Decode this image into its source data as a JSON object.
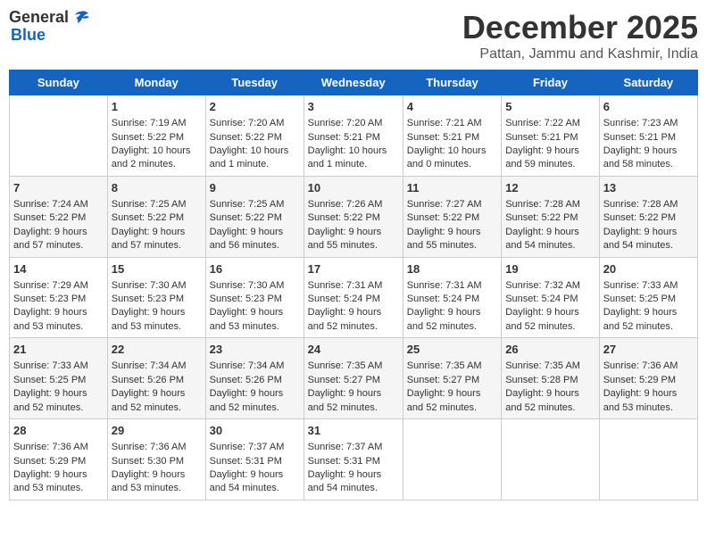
{
  "logo": {
    "general": "General",
    "blue": "Blue"
  },
  "title": "December 2025",
  "location": "Pattan, Jammu and Kashmir, India",
  "weekdays": [
    "Sunday",
    "Monday",
    "Tuesday",
    "Wednesday",
    "Thursday",
    "Friday",
    "Saturday"
  ],
  "weeks": [
    [
      {
        "day": "",
        "sunrise": "",
        "sunset": "",
        "daylight": ""
      },
      {
        "day": "1",
        "sunrise": "Sunrise: 7:19 AM",
        "sunset": "Sunset: 5:22 PM",
        "daylight": "Daylight: 10 hours and 2 minutes."
      },
      {
        "day": "2",
        "sunrise": "Sunrise: 7:20 AM",
        "sunset": "Sunset: 5:22 PM",
        "daylight": "Daylight: 10 hours and 1 minute."
      },
      {
        "day": "3",
        "sunrise": "Sunrise: 7:20 AM",
        "sunset": "Sunset: 5:21 PM",
        "daylight": "Daylight: 10 hours and 1 minute."
      },
      {
        "day": "4",
        "sunrise": "Sunrise: 7:21 AM",
        "sunset": "Sunset: 5:21 PM",
        "daylight": "Daylight: 10 hours and 0 minutes."
      },
      {
        "day": "5",
        "sunrise": "Sunrise: 7:22 AM",
        "sunset": "Sunset: 5:21 PM",
        "daylight": "Daylight: 9 hours and 59 minutes."
      },
      {
        "day": "6",
        "sunrise": "Sunrise: 7:23 AM",
        "sunset": "Sunset: 5:21 PM",
        "daylight": "Daylight: 9 hours and 58 minutes."
      }
    ],
    [
      {
        "day": "7",
        "sunrise": "Sunrise: 7:24 AM",
        "sunset": "Sunset: 5:22 PM",
        "daylight": "Daylight: 9 hours and 57 minutes."
      },
      {
        "day": "8",
        "sunrise": "Sunrise: 7:25 AM",
        "sunset": "Sunset: 5:22 PM",
        "daylight": "Daylight: 9 hours and 57 minutes."
      },
      {
        "day": "9",
        "sunrise": "Sunrise: 7:25 AM",
        "sunset": "Sunset: 5:22 PM",
        "daylight": "Daylight: 9 hours and 56 minutes."
      },
      {
        "day": "10",
        "sunrise": "Sunrise: 7:26 AM",
        "sunset": "Sunset: 5:22 PM",
        "daylight": "Daylight: 9 hours and 55 minutes."
      },
      {
        "day": "11",
        "sunrise": "Sunrise: 7:27 AM",
        "sunset": "Sunset: 5:22 PM",
        "daylight": "Daylight: 9 hours and 55 minutes."
      },
      {
        "day": "12",
        "sunrise": "Sunrise: 7:28 AM",
        "sunset": "Sunset: 5:22 PM",
        "daylight": "Daylight: 9 hours and 54 minutes."
      },
      {
        "day": "13",
        "sunrise": "Sunrise: 7:28 AM",
        "sunset": "Sunset: 5:22 PM",
        "daylight": "Daylight: 9 hours and 54 minutes."
      }
    ],
    [
      {
        "day": "14",
        "sunrise": "Sunrise: 7:29 AM",
        "sunset": "Sunset: 5:23 PM",
        "daylight": "Daylight: 9 hours and 53 minutes."
      },
      {
        "day": "15",
        "sunrise": "Sunrise: 7:30 AM",
        "sunset": "Sunset: 5:23 PM",
        "daylight": "Daylight: 9 hours and 53 minutes."
      },
      {
        "day": "16",
        "sunrise": "Sunrise: 7:30 AM",
        "sunset": "Sunset: 5:23 PM",
        "daylight": "Daylight: 9 hours and 53 minutes."
      },
      {
        "day": "17",
        "sunrise": "Sunrise: 7:31 AM",
        "sunset": "Sunset: 5:24 PM",
        "daylight": "Daylight: 9 hours and 52 minutes."
      },
      {
        "day": "18",
        "sunrise": "Sunrise: 7:31 AM",
        "sunset": "Sunset: 5:24 PM",
        "daylight": "Daylight: 9 hours and 52 minutes."
      },
      {
        "day": "19",
        "sunrise": "Sunrise: 7:32 AM",
        "sunset": "Sunset: 5:24 PM",
        "daylight": "Daylight: 9 hours and 52 minutes."
      },
      {
        "day": "20",
        "sunrise": "Sunrise: 7:33 AM",
        "sunset": "Sunset: 5:25 PM",
        "daylight": "Daylight: 9 hours and 52 minutes."
      }
    ],
    [
      {
        "day": "21",
        "sunrise": "Sunrise: 7:33 AM",
        "sunset": "Sunset: 5:25 PM",
        "daylight": "Daylight: 9 hours and 52 minutes."
      },
      {
        "day": "22",
        "sunrise": "Sunrise: 7:34 AM",
        "sunset": "Sunset: 5:26 PM",
        "daylight": "Daylight: 9 hours and 52 minutes."
      },
      {
        "day": "23",
        "sunrise": "Sunrise: 7:34 AM",
        "sunset": "Sunset: 5:26 PM",
        "daylight": "Daylight: 9 hours and 52 minutes."
      },
      {
        "day": "24",
        "sunrise": "Sunrise: 7:35 AM",
        "sunset": "Sunset: 5:27 PM",
        "daylight": "Daylight: 9 hours and 52 minutes."
      },
      {
        "day": "25",
        "sunrise": "Sunrise: 7:35 AM",
        "sunset": "Sunset: 5:27 PM",
        "daylight": "Daylight: 9 hours and 52 minutes."
      },
      {
        "day": "26",
        "sunrise": "Sunrise: 7:35 AM",
        "sunset": "Sunset: 5:28 PM",
        "daylight": "Daylight: 9 hours and 52 minutes."
      },
      {
        "day": "27",
        "sunrise": "Sunrise: 7:36 AM",
        "sunset": "Sunset: 5:29 PM",
        "daylight": "Daylight: 9 hours and 53 minutes."
      }
    ],
    [
      {
        "day": "28",
        "sunrise": "Sunrise: 7:36 AM",
        "sunset": "Sunset: 5:29 PM",
        "daylight": "Daylight: 9 hours and 53 minutes."
      },
      {
        "day": "29",
        "sunrise": "Sunrise: 7:36 AM",
        "sunset": "Sunset: 5:30 PM",
        "daylight": "Daylight: 9 hours and 53 minutes."
      },
      {
        "day": "30",
        "sunrise": "Sunrise: 7:37 AM",
        "sunset": "Sunset: 5:31 PM",
        "daylight": "Daylight: 9 hours and 54 minutes."
      },
      {
        "day": "31",
        "sunrise": "Sunrise: 7:37 AM",
        "sunset": "Sunset: 5:31 PM",
        "daylight": "Daylight: 9 hours and 54 minutes."
      },
      {
        "day": "",
        "sunrise": "",
        "sunset": "",
        "daylight": ""
      },
      {
        "day": "",
        "sunrise": "",
        "sunset": "",
        "daylight": ""
      },
      {
        "day": "",
        "sunrise": "",
        "sunset": "",
        "daylight": ""
      }
    ]
  ]
}
